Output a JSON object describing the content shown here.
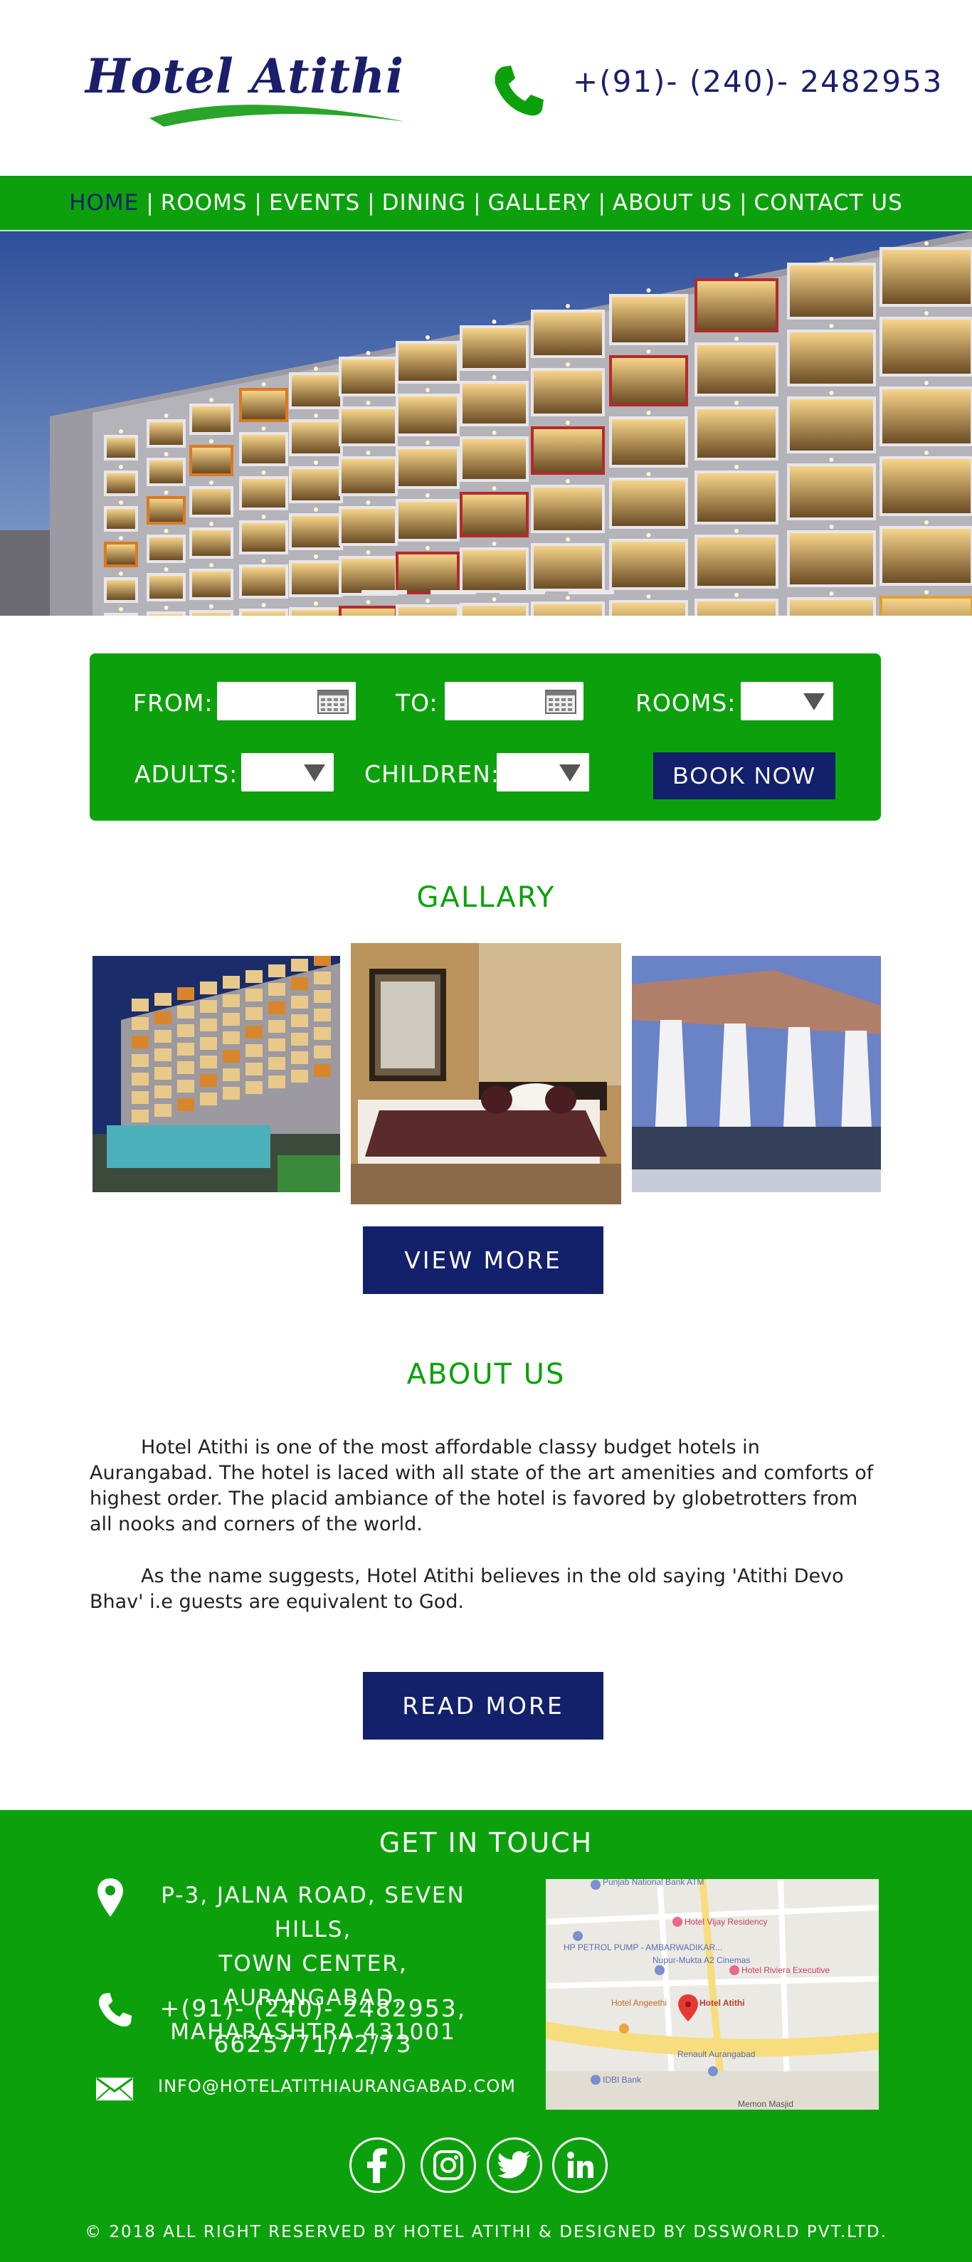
{
  "header": {
    "logo_text": "Hotel Atithi",
    "phone": "+(91)- (240)- 2482953"
  },
  "nav": {
    "items": [
      "HOME",
      "ROOMS",
      "EVENTS",
      "DINING",
      "GALLERY",
      "ABOUT US",
      "CONTACT US"
    ],
    "separator": "|",
    "active": "HOME"
  },
  "booking": {
    "from_label": "FROM:",
    "to_label": "TO:",
    "rooms_label": "ROOMS:",
    "adults_label": "ADULTS:",
    "children_label": "CHILDREN:",
    "book_button": "BOOK NOW"
  },
  "gallery": {
    "title": "GALLARY",
    "view_more": "VIEW MORE"
  },
  "about": {
    "title": "ABOUT US",
    "paragraph1": "Hotel Atithi is one of the most affordable classy budget hotels in Aurangabad. The hotel is laced with all state of the art amenities and comforts of highest order. The placid ambiance of the hotel is favored by globetrotters from all nooks and corners of the world.",
    "paragraph2": "As the name suggests, Hotel Atithi believes in the old saying 'Atithi Devo Bhav' i.e guests are equivalent to God.",
    "read_more": "READ MORE"
  },
  "footer": {
    "title": "GET IN TOUCH",
    "address_line1": "P-3, JALNA ROAD, SEVEN HILLS,",
    "address_line2": "TOWN CENTER, AURANGABAD,",
    "address_line3": "MAHARASHTRA 431001",
    "phone_line1": "+(91)- (240)- 2482953,",
    "phone_line2": "6625771/72/73",
    "email": "INFO@HOTELATITHIAURANGABAD.COM",
    "copyright": "© 2018 ALL RIGHT RESERVED BY HOTEL ATITHI & DESIGNED BY DSSWORLD PVT.LTD."
  },
  "map": {
    "labels": {
      "bank": "Punjab National Bank ATM",
      "vijay": "Hotel Vijay Residency",
      "petrol": "HP PETROL PUMP - AMBARWADIKAR...",
      "nupur": "Nupur-Mukta A2 Cinemas",
      "riviera": "Hotel Riviera Executive",
      "angeethi": "Hotel Angeethi",
      "atithi": "Hotel Atithi",
      "idbi": "IDBI Bank",
      "renault": "Renault Aurangabad",
      "masjid": "Memon Masjid"
    }
  },
  "colors": {
    "green": "#0ca10c",
    "navy": "#13206b",
    "white": "#ffffff"
  },
  "icons": {
    "phone": "phone-icon",
    "location": "location-pin-icon",
    "email": "envelope-icon",
    "calendar": "calendar-icon",
    "dropdown": "dropdown-arrow-icon",
    "facebook": "facebook-icon",
    "instagram": "instagram-icon",
    "twitter": "twitter-icon",
    "linkedin": "linkedin-icon"
  }
}
